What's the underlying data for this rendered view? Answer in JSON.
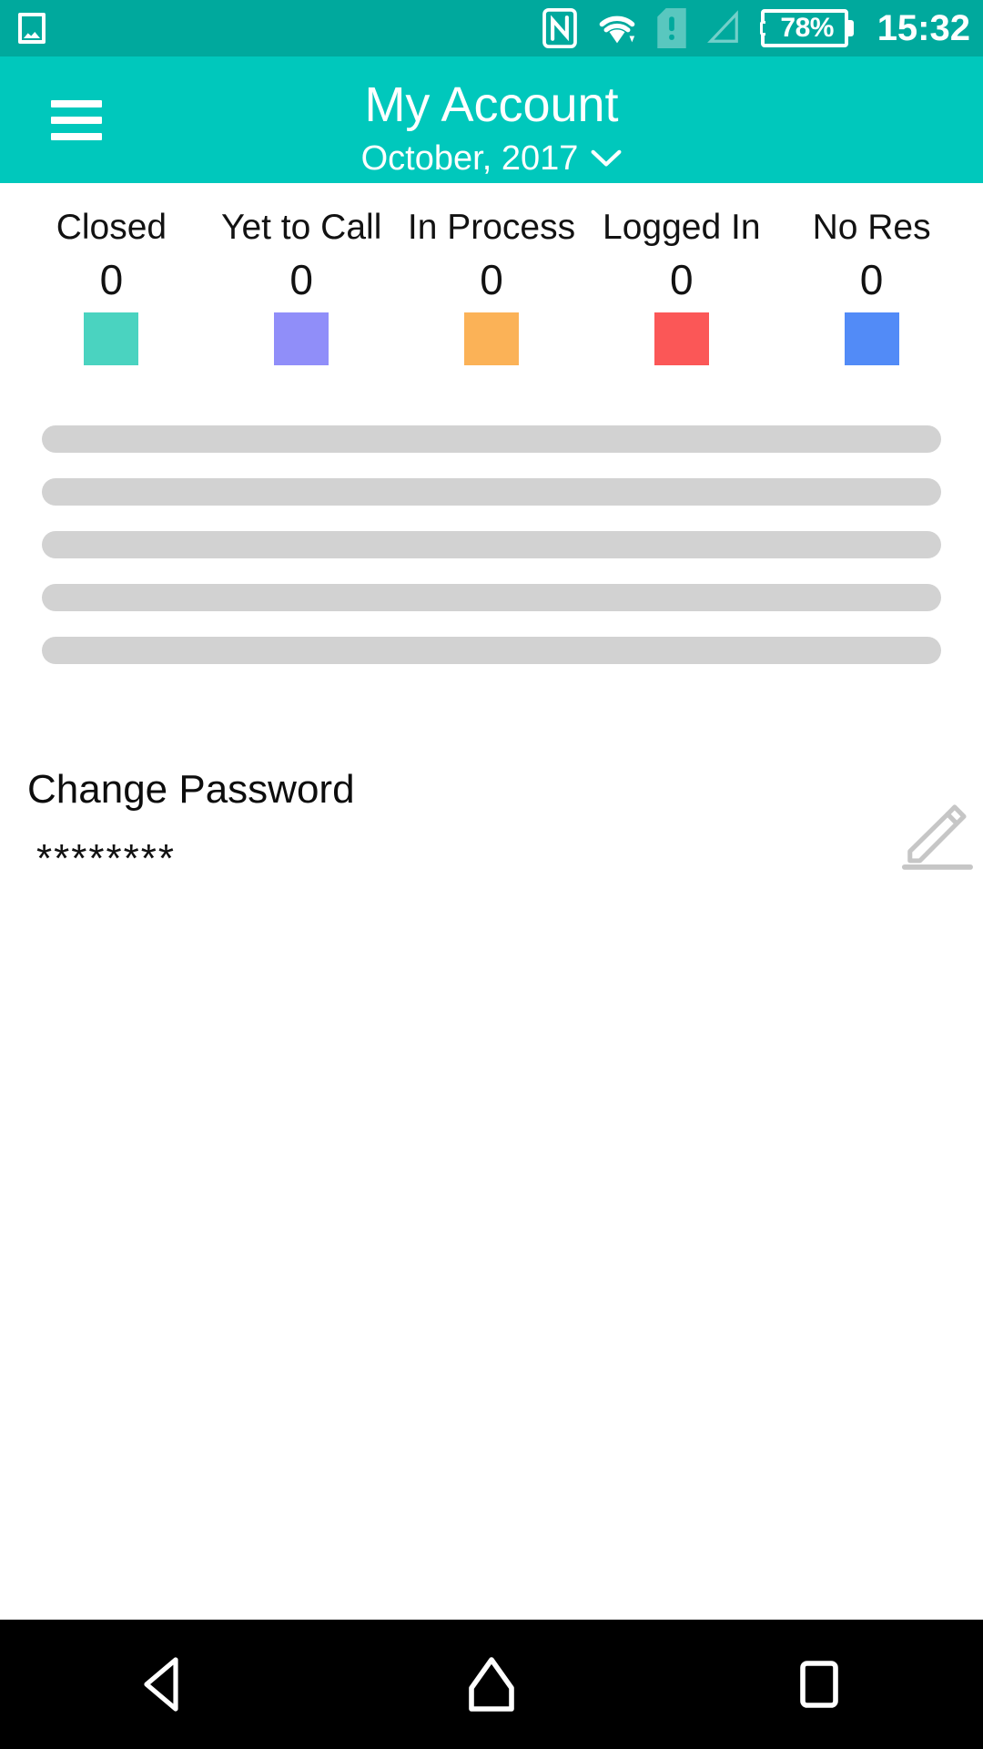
{
  "status_bar": {
    "background": "#00a99d",
    "notification_icon": "image-icon",
    "icons": [
      "nfc-icon",
      "wifi-icon",
      "sim-card-missing-icon",
      "cellular-signal-icon"
    ],
    "battery_percent": "78%",
    "time": "15:32"
  },
  "app_bar": {
    "background": "#00c8bc",
    "menu_icon": "hamburger-menu-icon",
    "title": "My Account",
    "subtitle": "October, 2017",
    "subtitle_chevron": "chevron-down-icon"
  },
  "stats": [
    {
      "label": "Closed",
      "value": "0",
      "color": "#4ad3c0"
    },
    {
      "label": "Yet to Call",
      "value": "0",
      "color": "#908ef9"
    },
    {
      "label": "In Process",
      "value": "0",
      "color": "#fbb257"
    },
    {
      "label": "Logged In",
      "value": "0",
      "color": "#fb5757"
    },
    {
      "label": "No Res",
      "value": "0",
      "color": "#528bf7"
    }
  ],
  "skeleton": {
    "bar_color": "#d2d2d2",
    "count": 5
  },
  "password": {
    "section_label": "Change Password",
    "masked_value": "********",
    "edit_icon": "pencil-edit-icon"
  },
  "nav_bar": {
    "background": "#000000",
    "buttons": [
      {
        "name": "back-button",
        "icon": "back-triangle-icon"
      },
      {
        "name": "home-button",
        "icon": "home-icon"
      },
      {
        "name": "recents-button",
        "icon": "square-recents-icon"
      }
    ]
  }
}
